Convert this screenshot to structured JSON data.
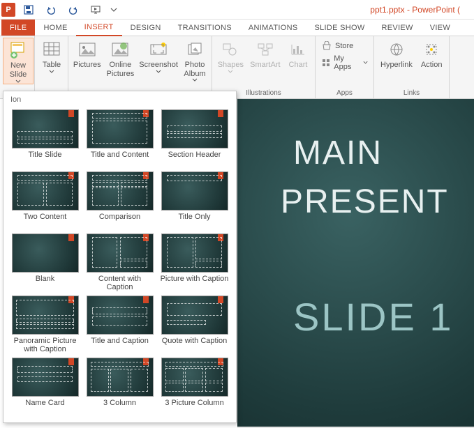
{
  "titlebar": {
    "app_title": "ppt1.pptx - PowerPoint ("
  },
  "tabs": {
    "file": "FILE",
    "home": "HOME",
    "insert": "INSERT",
    "design": "DESIGN",
    "transitions": "TRANSITIONS",
    "animations": "ANIMATIONS",
    "slideshow": "SLIDE SHOW",
    "review": "REVIEW",
    "view": "VIEW"
  },
  "ribbon": {
    "new_slide": "New\nSlide",
    "table": "Table",
    "pictures": "Pictures",
    "online_pictures": "Online\nPictures",
    "screenshot": "Screenshot",
    "photo_album": "Photo\nAlbum",
    "shapes": "Shapes",
    "smartart": "SmartArt",
    "chart": "Chart",
    "store": "Store",
    "my_apps": "My Apps",
    "hyperlink": "Hyperlink",
    "action": "Action",
    "group_illustrations": "Illustrations",
    "group_apps": "Apps",
    "group_links": "Links",
    "group_slides": "",
    "group_tables": "",
    "group_images": ""
  },
  "gallery": {
    "theme": "Ion",
    "items": [
      "Title Slide",
      "Title and Content",
      "Section Header",
      "Two Content",
      "Comparison",
      "Title Only",
      "Blank",
      "Content with Caption",
      "Picture with Caption",
      "Panoramic Picture with Caption",
      "Title and Caption",
      "Quote with Caption",
      "Name Card",
      "3 Column",
      "3 Picture Column"
    ]
  },
  "slide": {
    "line1": "MAIN",
    "line2": "PRESENT",
    "line3": "SLIDE 1"
  }
}
